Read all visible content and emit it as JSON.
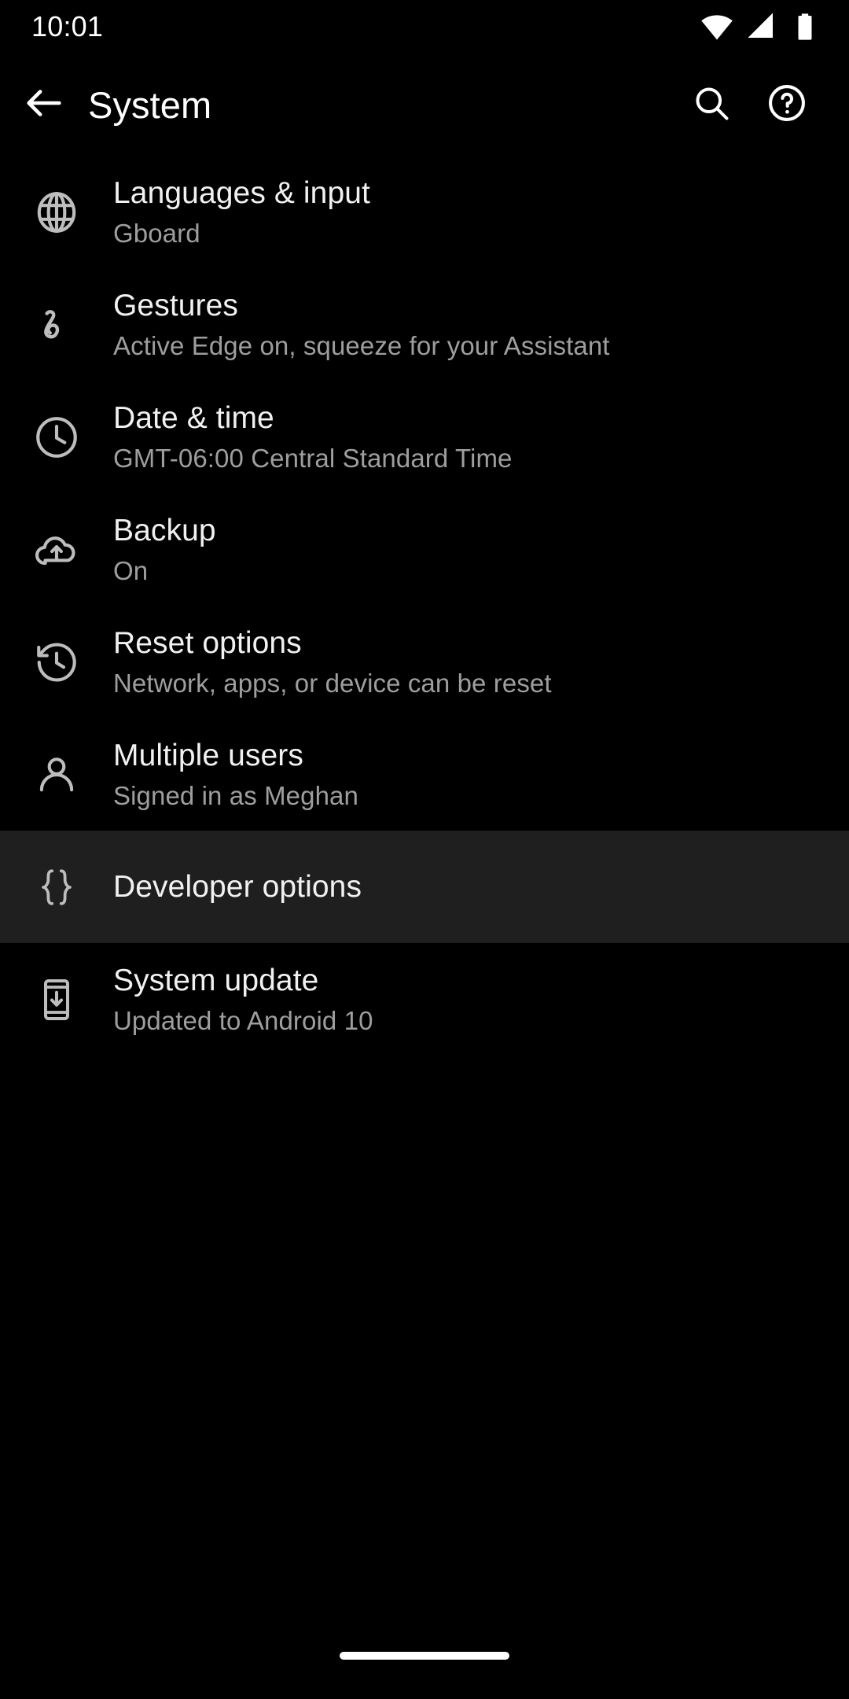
{
  "status_bar": {
    "time": "10:01",
    "icons": [
      {
        "name": "wifi-icon",
        "label": "Wi-Fi full signal"
      },
      {
        "name": "cell-signal-icon",
        "label": "Mobile signal"
      },
      {
        "name": "battery-icon",
        "label": "Battery full"
      }
    ]
  },
  "app_bar": {
    "back_label": "Navigate up",
    "title": "System",
    "search_label": "Search settings",
    "help_label": "Help & feedback"
  },
  "settings_list": {
    "items": [
      {
        "icon": "globe-icon",
        "title": "Languages & input",
        "subtitle": "Gboard",
        "selected": false
      },
      {
        "icon": "gesture-icon",
        "title": "Gestures",
        "subtitle": "Active Edge on, squeeze for your Assistant",
        "selected": false
      },
      {
        "icon": "clock-icon",
        "title": "Date & time",
        "subtitle": "GMT-06:00 Central Standard Time",
        "selected": false
      },
      {
        "icon": "cloud-upload-icon",
        "title": "Backup",
        "subtitle": "On",
        "selected": false
      },
      {
        "icon": "history-restore-icon",
        "title": "Reset options",
        "subtitle": "Network, apps, or device can be reset",
        "selected": false
      },
      {
        "icon": "person-icon",
        "title": "Multiple users",
        "subtitle": "Signed in as Meghan",
        "selected": false
      },
      {
        "icon": "braces-icon",
        "title": "Developer options",
        "subtitle": "",
        "selected": true
      },
      {
        "icon": "system-update-icon",
        "title": "System update",
        "subtitle": "Updated to Android 10",
        "selected": false
      }
    ]
  },
  "nav_bar": {
    "home_pill_label": "Home gesture handle"
  },
  "colors": {
    "background": "#000000",
    "selected_row": "#1f1f1f",
    "primary_text": "#f1f1f1",
    "secondary_text": "#9e9e9e",
    "icon": "#bdbdbd",
    "status_icon": "#ffffff"
  }
}
